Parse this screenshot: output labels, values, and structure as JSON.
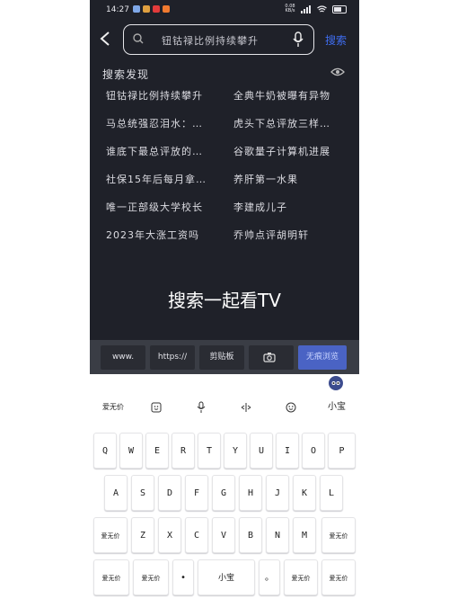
{
  "status_bar": {
    "time": "14:27",
    "network": "0.08 KB/s",
    "app_icon_colors": [
      "#7fa8e8",
      "#e0a040",
      "#e23b3b",
      "#f07a30"
    ]
  },
  "search": {
    "query": "钮钴禄比例持续攀升",
    "button": "搜索"
  },
  "discovery": {
    "title": "搜索发现",
    "items": [
      "钮钴禄比例持续攀升",
      "全典牛奶被曝有异物",
      "马总统强忍泪水：…",
      "虎头下总评放三样…",
      "谁底下最总评放的…",
      "谷歌量子计算机进展",
      "社保15年后每月拿…",
      "养肝第一水果",
      "唯一正部级大学校长",
      "李建成儿子",
      "2023年大涨工资吗",
      "乔帅点评胡明轩"
    ]
  },
  "watermark": "搜索一起看TV",
  "shortcuts": [
    "www.",
    "https://",
    "剪贴板",
    "camera-icon",
    "无痕浏览"
  ],
  "keyboard": {
    "toolbar": {
      "left": "爱无价",
      "right": "小宝"
    },
    "row1": [
      "Q",
      "W",
      "E",
      "R",
      "T",
      "Y",
      "U",
      "I",
      "O",
      "P"
    ],
    "row2": [
      "A",
      "S",
      "D",
      "F",
      "G",
      "H",
      "J",
      "K",
      "L"
    ],
    "row3": {
      "left": "爱无价",
      "keys": [
        "Z",
        "X",
        "C",
        "V",
        "B",
        "N",
        "M"
      ],
      "right": "爱无价"
    },
    "row4": [
      "爱无价",
      "爱无价",
      "•",
      "小宝",
      "。",
      "爱无价",
      "爱无价"
    ]
  },
  "colors": {
    "dark_bg": "#1f2129",
    "accent": "#3f6df0"
  }
}
